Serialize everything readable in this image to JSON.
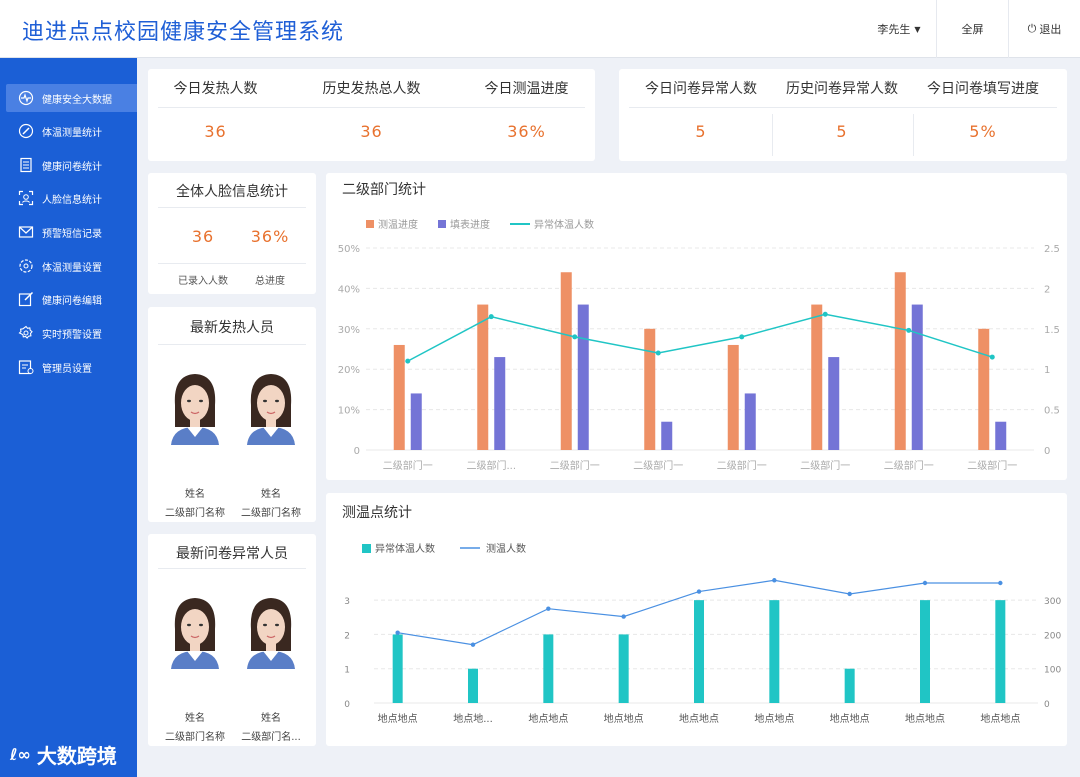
{
  "header": {
    "title": "迪进点点校园健康安全管理系统",
    "user": "李先生",
    "fullscreen": "全屏",
    "logout": "退出"
  },
  "sidebar": {
    "items": [
      {
        "label": "健康安全大数据",
        "icon": "heartbeat-icon"
      },
      {
        "label": "体温测量统计",
        "icon": "edit-icon"
      },
      {
        "label": "健康问卷统计",
        "icon": "document-icon"
      },
      {
        "label": "人脸信息统计",
        "icon": "face-scan-icon"
      },
      {
        "label": "预警短信记录",
        "icon": "mail-icon"
      },
      {
        "label": "体温测量设置",
        "icon": "settings-icon"
      },
      {
        "label": "健康问卷编辑",
        "icon": "compose-icon"
      },
      {
        "label": "实时预警设置",
        "icon": "gear-icon"
      },
      {
        "label": "管理员设置",
        "icon": "admin-icon"
      }
    ]
  },
  "stats_temp": {
    "today_fever_label": "今日发热人数",
    "today_fever": "36",
    "total_fever_label": "历史发热总人数",
    "total_fever": "36",
    "progress_label": "今日测温进度",
    "progress": "36%"
  },
  "stats_survey": {
    "today_abn_label": "今日问卷异常人数",
    "today_abn": "5",
    "total_abn_label": "历史问卷异常人数",
    "total_abn": "5",
    "progress_label": "今日问卷填写进度",
    "progress": "5%"
  },
  "face": {
    "title": "全体人脸信息统计",
    "count": "36",
    "count_label": "已录入人数",
    "progress": "36%",
    "progress_label": "总进度"
  },
  "fever_people": {
    "title": "最新发热人员",
    "people": [
      {
        "name": "姓名",
        "dept": "二级部门名称"
      },
      {
        "name": "姓名",
        "dept": "二级部门名称"
      }
    ]
  },
  "survey_people": {
    "title": "最新问卷异常人员",
    "people": [
      {
        "name": "姓名",
        "dept": "二级部门名称"
      },
      {
        "name": "姓名",
        "dept": "二级部门名..."
      }
    ]
  },
  "colors": {
    "primary": "#1b5fd6",
    "orange": "#ee9065",
    "purple": "#7474d6",
    "teal": "#20c5c5",
    "accent": "#e8722f"
  },
  "chart_data": [
    {
      "type": "bar",
      "title": "二级部门统计",
      "legend": [
        "测温进度",
        "填表进度",
        "异常体温人数"
      ],
      "categories": [
        "二级部门一",
        "二级部门...",
        "二级部门一",
        "二级部门一",
        "二级部门一",
        "二级部门一",
        "二级部门一",
        "二级部门一"
      ],
      "series": [
        {
          "name": "测温进度",
          "values": [
            26,
            36,
            44,
            30,
            26,
            36,
            44,
            30
          ]
        },
        {
          "name": "填表进度",
          "values": [
            14,
            23,
            36,
            7,
            14,
            23,
            36,
            7
          ]
        },
        {
          "name": "异常体温人数",
          "values": [
            1.1,
            1.65,
            1.4,
            1.2,
            1.4,
            1.68,
            1.48,
            1.15
          ]
        }
      ],
      "y_left_ticks": [
        "0",
        "10%",
        "20%",
        "30%",
        "40%",
        "50%"
      ],
      "y_right_ticks": [
        "0",
        "0.5",
        "1",
        "1.5",
        "2",
        "2.5"
      ],
      "ylim_left": [
        0,
        50
      ],
      "ylim_right": [
        0,
        2.5
      ]
    },
    {
      "type": "bar",
      "title": "测温点统计",
      "legend": [
        "异常体温人数",
        "测温人数"
      ],
      "categories": [
        "地点地点",
        "地点地...",
        "地点地点",
        "地点地点",
        "地点地点",
        "地点地点",
        "地点地点",
        "地点地点",
        "地点地点"
      ],
      "series": [
        {
          "name": "异常体温人数",
          "values": [
            2,
            1,
            2,
            2,
            3,
            3,
            1,
            3,
            3
          ]
        },
        {
          "name": "测温人数",
          "values": [
            205,
            170,
            275,
            252,
            325,
            358,
            318,
            350,
            350
          ]
        }
      ],
      "y_left_ticks": [
        "0",
        "1",
        "2",
        "3"
      ],
      "y_right_ticks": [
        "0",
        "100",
        "200",
        "300"
      ],
      "ylim_left": [
        0,
        3.5
      ],
      "ylim_right": [
        0,
        350
      ]
    }
  ]
}
